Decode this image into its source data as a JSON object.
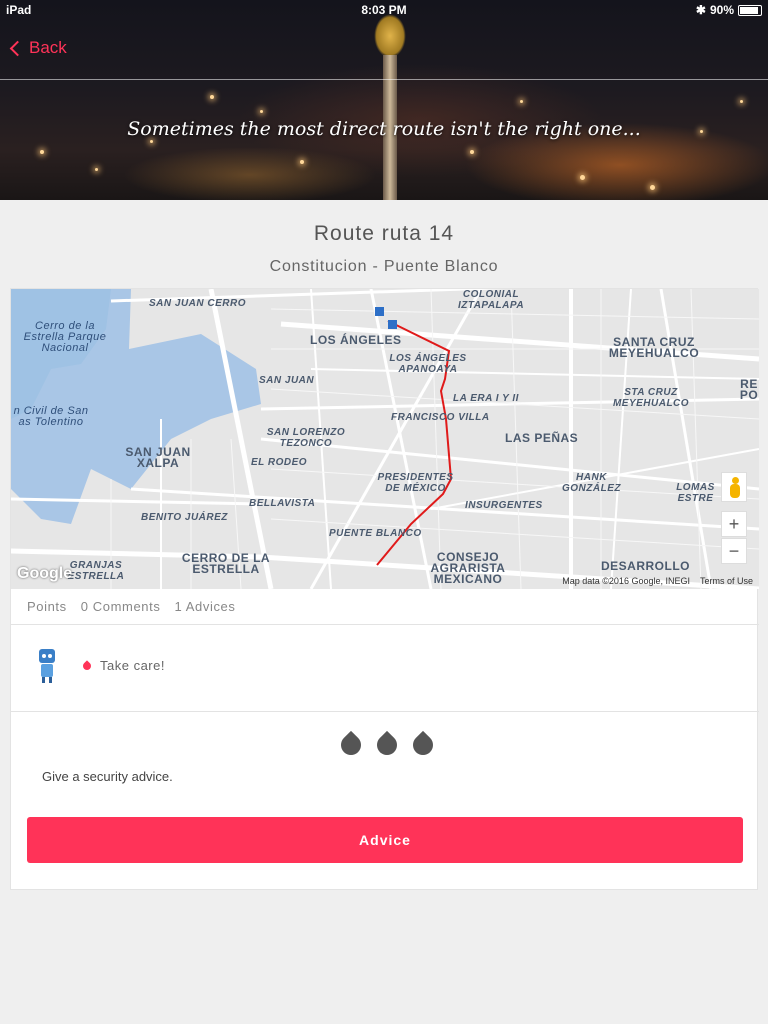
{
  "status_bar": {
    "device": "iPad",
    "time": "8:03 PM",
    "battery": "90%"
  },
  "nav": {
    "back_label": "Back"
  },
  "hero": {
    "tagline": "Sometimes the most direct route isn't the right one..."
  },
  "route": {
    "title": "Route ruta 14",
    "subtitle": "Constitucion - Puente Blanco"
  },
  "map": {
    "labels": [
      "SAN JUAN CERRO",
      "COLONIAL IZTAPALAPA",
      "Cerro de la Estrella Parque Nacional",
      "LOS ÁNGELES",
      "LOS ÁNGELES APANOAYA",
      "SANTA CRUZ MEYEHUALCO",
      "SAN JUAN",
      "LA ERA I Y II",
      "STA CRUZ MEYEHUALCO",
      "n Civil de San as Tolentino",
      "FRANCISCO VILLA",
      "SAN LORENZO TEZONCO",
      "LAS PEÑAS",
      "SAN JUAN XALPA",
      "EL RODEO",
      "PRESIDENTES DE MÉXICO",
      "HANK GONZÁLEZ",
      "LOMAS ESTRE",
      "BELLAVISTA",
      "INSURGENTES",
      "BENITO JUÁREZ",
      "PUENTE BLANCO",
      "GRANJAS ESTRELLA",
      "CERRO DE LA ESTRELLA",
      "CONSEJO AGRARISTA MEXICANO",
      "DESARROLLO",
      "RE PO"
    ],
    "logo": "Google",
    "attribution": "Map data ©2016 Google, INEGI",
    "terms": "Terms of Use",
    "zoom_in": "+",
    "zoom_out": "−",
    "route_color": "#e01a1a"
  },
  "stats": {
    "points": "Points",
    "comments": "0 Comments",
    "advices": "1 Advices"
  },
  "advices": [
    {
      "text": "Take care!"
    }
  ],
  "rating": {
    "drops": 3,
    "prompt": "Give a security advice."
  },
  "action": {
    "button_label": "Advice"
  },
  "colors": {
    "accent": "#ff3358",
    "background": "#efefef"
  }
}
